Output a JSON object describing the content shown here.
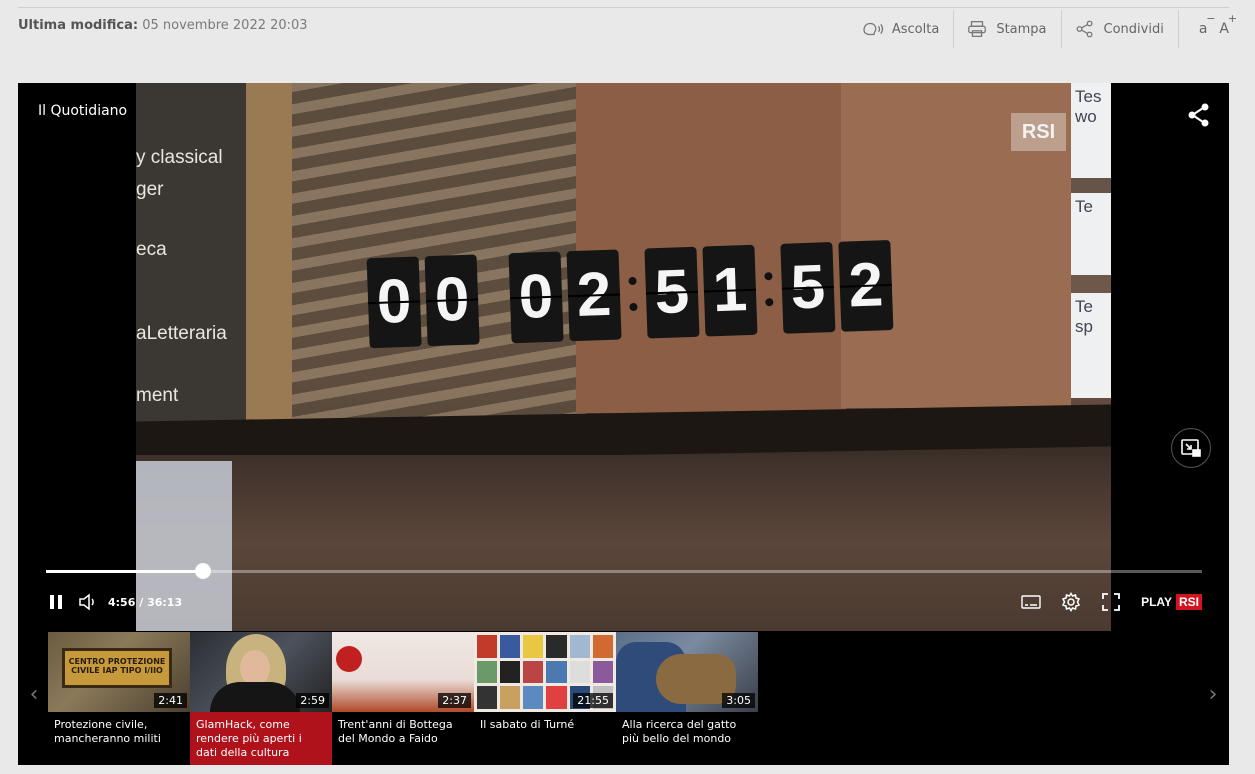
{
  "meta": {
    "last_modified_label": "Ultima modifica:",
    "last_modified_value": "05 novembre 2022 20:03"
  },
  "toolbar": {
    "listen_label": "Ascolta",
    "print_label": "Stampa",
    "share_label": "Condividi",
    "font_decrease": "a",
    "font_decrease_sign": "−",
    "font_increase": "A",
    "font_increase_sign": "+"
  },
  "player": {
    "show_title": "Il Quotidiano",
    "current_time": "4:56",
    "time_separator": "/",
    "total_time": "36:13",
    "progress_fraction": 0.136,
    "brand_play": "PLAY",
    "brand_rsi": "RSI"
  },
  "video_frame": {
    "watermark": "RSI",
    "clock_digits": [
      "0",
      "0",
      "0",
      "2",
      "5",
      "1",
      "5",
      "2"
    ],
    "side_texts": [
      "y classical",
      "ger",
      "eca",
      "aLetteraria",
      "ment"
    ],
    "paper_texts": [
      "Tes wo",
      "Te",
      "Te sp"
    ]
  },
  "playlist": {
    "items": [
      {
        "title": "Protezione civile, mancheranno militi",
        "duration": "2:41",
        "sign_text": "CENTRO PROTEZIONE CIVILE IAP TIPO I/IIO"
      },
      {
        "title": "GlamHack, come rendere più aperti i dati della cultura",
        "duration": "2:59",
        "active": true
      },
      {
        "title": "Trent'anni di Bottega del Mondo a Faido",
        "duration": "2:37"
      },
      {
        "title": "Il sabato di Turné",
        "duration": "21:55"
      },
      {
        "title": "Alla ricerca del gatto più bello del mondo",
        "duration": "3:05"
      }
    ]
  },
  "colors": {
    "background": "#e9e9e9",
    "player_bg": "#000000",
    "active_item": "#b0121c",
    "rsi_red": "#d3141f"
  },
  "icons": {
    "listen": "speaker-head-icon",
    "print": "printer-icon",
    "share": "share-icon",
    "pause": "pause-icon",
    "volume": "volume-icon",
    "subtitles": "subtitles-icon",
    "settings": "gear-icon",
    "fullscreen": "fullscreen-icon",
    "pip": "picture-in-picture-icon",
    "prev": "chevron-left-icon",
    "next": "chevron-right-icon"
  }
}
